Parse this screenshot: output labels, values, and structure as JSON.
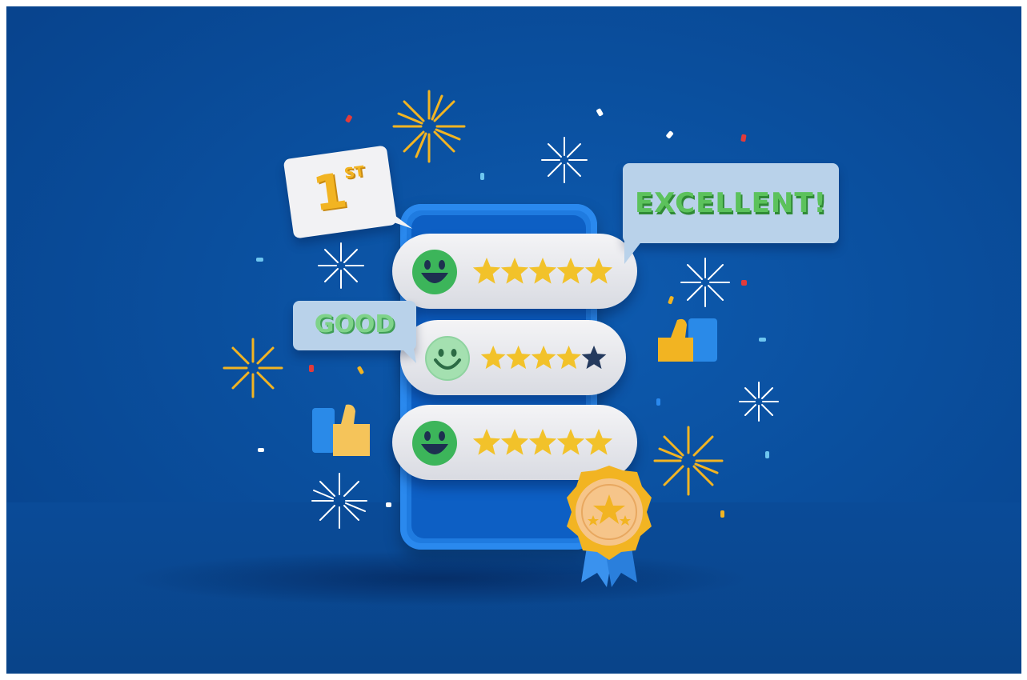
{
  "scene": {
    "bubbles": {
      "first": {
        "main": "1",
        "suffix": "ST"
      },
      "excellent": "EXCELLENT!",
      "good": "GOOD"
    },
    "rating_cards": [
      {
        "rating": 5,
        "max": 5,
        "face": "big-smile"
      },
      {
        "rating": 4,
        "max": 5,
        "face": "smile"
      },
      {
        "rating": 5,
        "max": 5,
        "face": "big-smile"
      }
    ]
  },
  "colors": {
    "background": "#0a4f9e",
    "star_filled": "#f2c22a",
    "star_empty": "#243a5e",
    "face_green": "#3cb55a",
    "face_light": "#a4e0b0",
    "phone": "#1f7be0"
  },
  "icons": [
    "firework-icon",
    "thumbs-up-icon",
    "award-badge-icon",
    "star-icon",
    "smiley-icon",
    "confetti-icon"
  ]
}
